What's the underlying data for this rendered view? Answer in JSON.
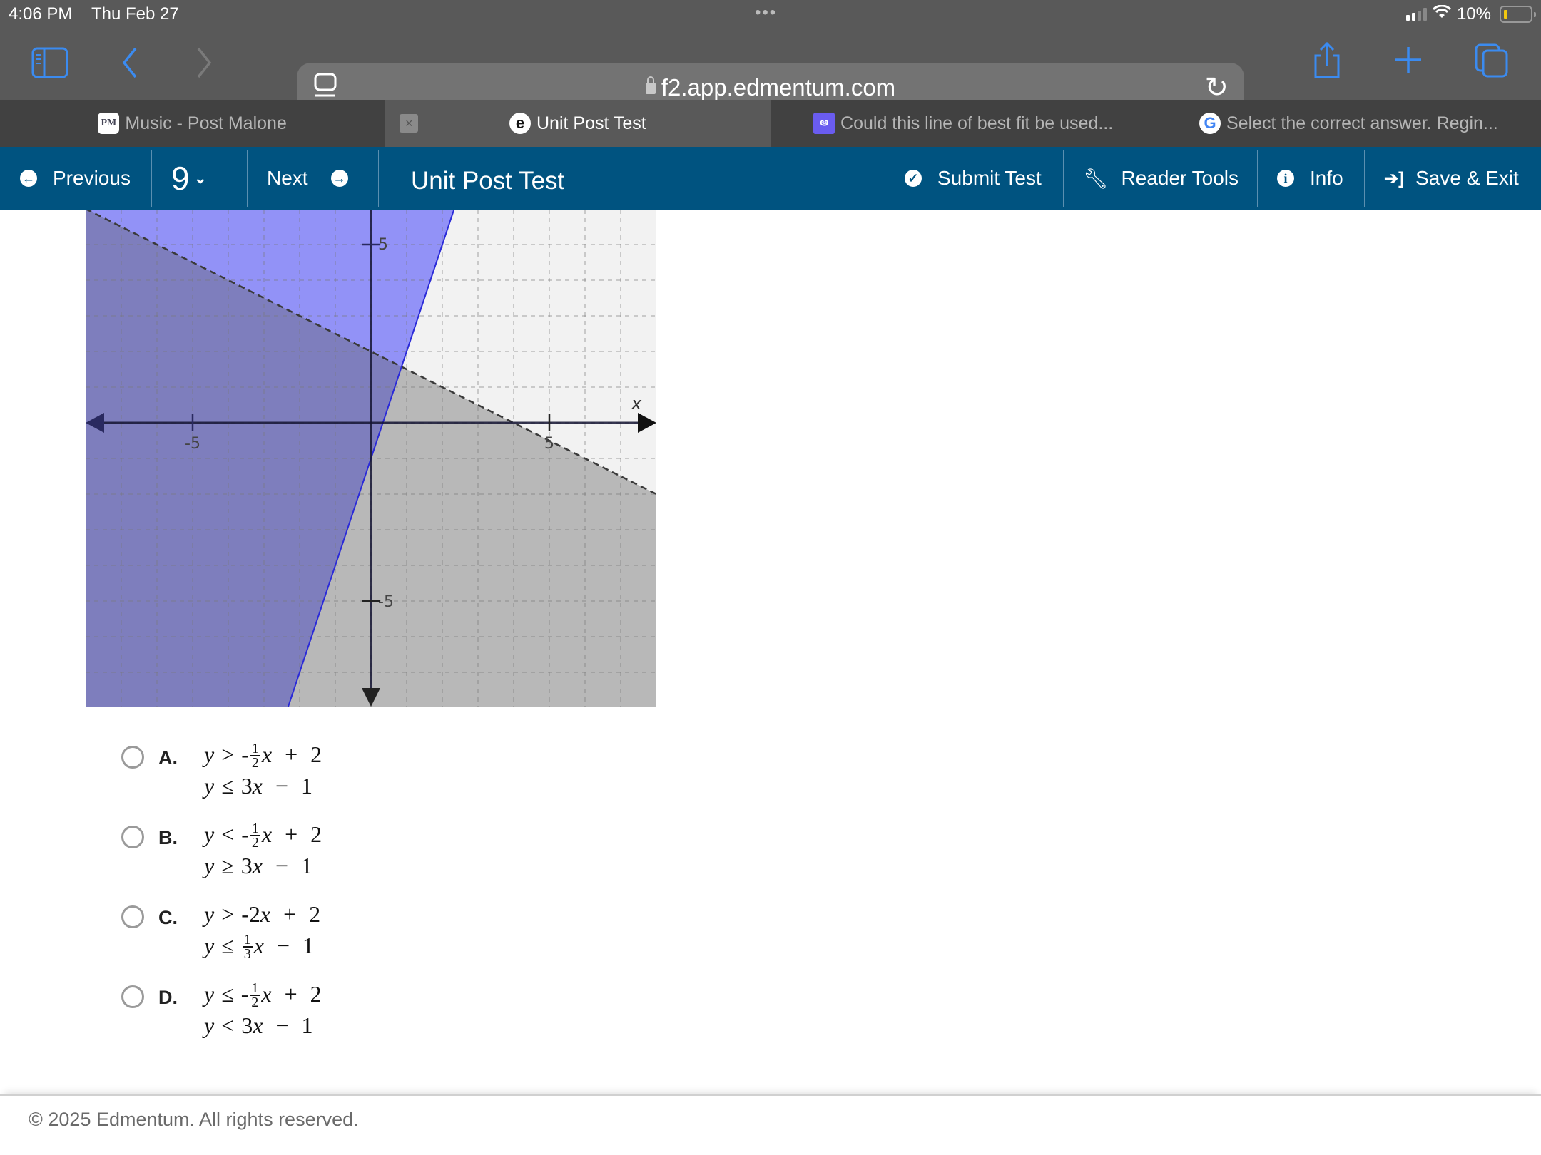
{
  "status_bar": {
    "time": "4:06 PM",
    "date": "Thu Feb 27",
    "battery_percent": "10%",
    "battery_level": 0.1
  },
  "browser": {
    "url": "f2.app.edmentum.com",
    "icons": [
      "sidebar-icon",
      "back-icon",
      "forward-icon",
      "reader-icon",
      "lock-icon",
      "reload-icon",
      "share-icon",
      "new-tab-icon",
      "tabs-icon"
    ],
    "tabs": [
      {
        "label": "Music - Post Malone",
        "favicon": "PM",
        "active": false
      },
      {
        "label": "Unit Post Test",
        "favicon": "edmentum",
        "active": true
      },
      {
        "label": "Could this line of best fit be used...",
        "favicon": "brainly",
        "active": false
      },
      {
        "label": "Select the correct answer. Regin...",
        "favicon": "G",
        "active": false
      }
    ]
  },
  "nav": {
    "previous": "Previous",
    "question_number": "9",
    "next": "Next",
    "title": "Unit Post Test",
    "submit": "Submit Test",
    "reader_tools": "Reader Tools",
    "info": "Info",
    "save_exit": "Save & Exit",
    "brand_color": "#005380"
  },
  "graph": {
    "x_label": "x",
    "tick_labels": {
      "x_neg": "-5",
      "x_pos": "5",
      "y_pos": "5",
      "y_neg": "-5"
    },
    "x_range": [
      -8,
      8
    ],
    "y_range": [
      -8,
      6
    ],
    "lines": [
      {
        "equation": "y = -1/2 x + 2",
        "style": "dashed",
        "color": "#333333",
        "shade": "below",
        "shade_color": "#a0a0a0"
      },
      {
        "equation": "y = 3x - 1",
        "style": "solid",
        "color": "#2a2ad8",
        "shade": "above",
        "shade_color": "#7b7bf0"
      }
    ],
    "colors": {
      "background": "#f2f2f2",
      "gray": "#b8b8b8",
      "blue": "#9292f7",
      "overlap": "#7e7ebd"
    }
  },
  "choices": [
    {
      "letter": "A.",
      "line1": {
        "rel": ">",
        "expr": [
          "-",
          "1",
          "2",
          "x + 2"
        ],
        "type": "frac"
      },
      "line2": {
        "rel": "≤",
        "expr_text": "3x − 1"
      }
    },
    {
      "letter": "B.",
      "line1": {
        "rel": "<",
        "expr": [
          "-",
          "1",
          "2",
          "x + 2"
        ],
        "type": "frac"
      },
      "line2": {
        "rel": "≥",
        "expr_text": "3x − 1"
      }
    },
    {
      "letter": "C.",
      "line1": {
        "rel": ">",
        "expr_text": "-2x + 2"
      },
      "line2": {
        "rel": "≤",
        "expr": [
          "",
          "1",
          "3",
          "x − 1"
        ],
        "type": "frac"
      }
    },
    {
      "letter": "D.",
      "line1": {
        "rel": "≤",
        "expr": [
          "-",
          "1",
          "2",
          "x + 2"
        ],
        "type": "frac"
      },
      "line2": {
        "rel": "<",
        "expr_text": "3x − 1"
      }
    }
  ],
  "footer": {
    "copyright": "© 2025 Edmentum. All rights reserved."
  }
}
